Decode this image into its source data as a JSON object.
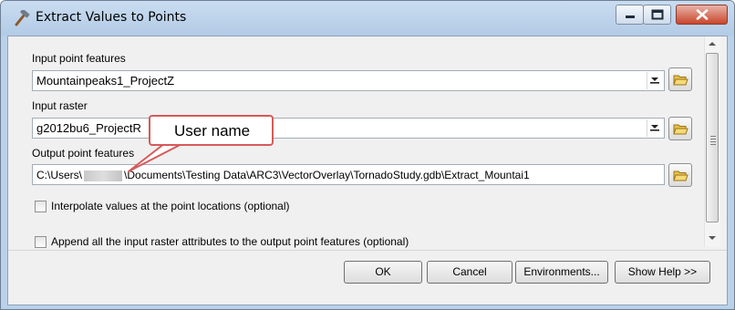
{
  "window": {
    "title": "Extract Values to Points",
    "app_icon": "hammer-icon",
    "controls": {
      "minimize": "minimize-icon",
      "maximize": "maximize-icon",
      "close": "close-icon"
    }
  },
  "form": {
    "input_point_features": {
      "label": "Input point features",
      "value": "Mountainpeaks1_ProjectZ"
    },
    "input_raster": {
      "label": "Input raster",
      "value": "g2012bu6_ProjectR"
    },
    "output_point_features": {
      "label": "Output point features",
      "value_prefix": "C:\\Users\\",
      "value_suffix": "\\Documents\\Testing Data\\ARC3\\VectorOverlay\\TornadoStudy.gdb\\Extract_Mountai1"
    },
    "interpolate": {
      "label": "Interpolate values at the point locations (optional)",
      "checked": false
    },
    "append_attributes": {
      "label": "Append all the input raster attributes to the output point features (optional)",
      "checked": false
    }
  },
  "callout": {
    "text": "User name"
  },
  "buttons": {
    "ok": "OK",
    "cancel": "Cancel",
    "environments": "Environments...",
    "show_help": "Show Help >>"
  },
  "colors": {
    "frame": "#b9d1ea",
    "client": "#f0f0f0",
    "callout_border": "#d65a5a",
    "close_button": "#c9462c"
  }
}
